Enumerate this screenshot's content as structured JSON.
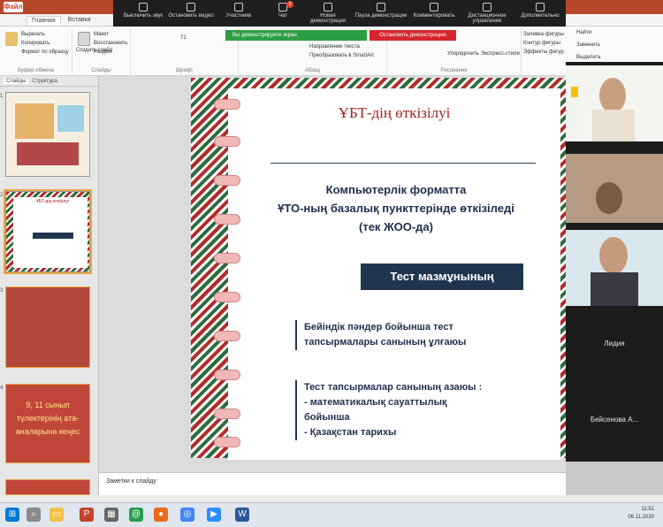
{
  "ppt": {
    "file_tab": "Файл",
    "tabs": [
      "Главная",
      "Вставка"
    ],
    "ribbon": {
      "cut": "Вырезать",
      "copy": "Копировать",
      "format_painter": "Формат по образцу",
      "clipboard_group": "Буфер обмена",
      "new_slide": "Создать слайд",
      "layout": "Макет",
      "reset": "Восстановить",
      "section": "Раздел",
      "slides_group": "Слайды",
      "font_size": "72",
      "font_group": "Шрифт",
      "text_direction": "Направление текста",
      "smartart": "Преобразовать в SmartArt",
      "paragraph_group": "Абзац",
      "arrange": "Упорядочить",
      "quick_styles": "Экспресс-стили",
      "drawing_group": "Рисование",
      "shape_fill": "Заливка фигуры",
      "shape_outline": "Контур фигуры",
      "shape_effects": "Эффекты фигур",
      "find": "Найти",
      "replace": "Заменить",
      "select": "Выделить"
    },
    "pane_tabs": [
      "Слайды",
      "Структура"
    ],
    "thumbnails": [
      {
        "number": "1"
      },
      {
        "number": "2",
        "title": "ҰБТ-дің өткізілуі"
      },
      {
        "number": "3",
        "text": ""
      },
      {
        "number": "4",
        "text": "9, 11 сынып түлектерінің ата-аналарына кеңес"
      }
    ],
    "notes_placeholder": "Заметки к слайду",
    "status": ""
  },
  "zoom": {
    "toolbar": {
      "mute": "Выключить звук",
      "video": "Остановить видео",
      "participants": "Участники",
      "chat": "Чат",
      "chat_badge": "5",
      "new_share": "Новая демонстрация",
      "pause_share": "Пауза демонстрации",
      "annotate": "Комментировать",
      "remote_control": "Дистанционное управление",
      "more": "Дополнительно"
    },
    "sharing_banner": "Вы демонстрируете экран",
    "stop_share": "Остановить демонстрацию",
    "participants": [
      {
        "name": ""
      },
      {
        "name": ""
      },
      {
        "name": ""
      },
      {
        "name": "Лидия"
      },
      {
        "name": ""
      },
      {
        "name": "Бейсенова А..."
      }
    ]
  },
  "slide": {
    "title": "ҰБТ-дің өткізілуі",
    "subtitle": [
      "Компьютерлік форматта",
      "ҰТО-ның базалық пункттерінде өткізіледі",
      "(тек ЖОО-да)"
    ],
    "box_heading": "Тест мазмұнының форматы:",
    "block1": [
      "Бейіндік пәндер бойынша тест",
      "тапсырмалары санының ұлғаюы"
    ],
    "block2": [
      "Тест тапсырмалар санының азаюы :",
      "- математикалық сауаттылық бойынша",
      "- Қазақстан тарихы"
    ]
  },
  "taskbar": {
    "time": "11:51",
    "date": "06.11.2020"
  }
}
